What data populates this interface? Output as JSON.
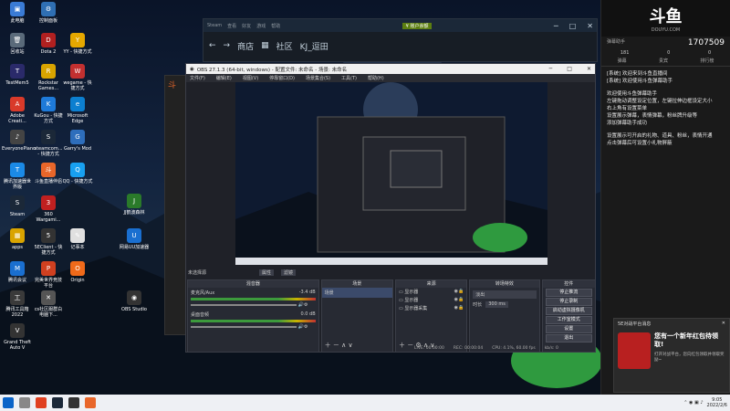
{
  "desktop": {
    "icons": [
      {
        "label": "此电脑",
        "color": "#3a7bd5",
        "glyph": "▣"
      },
      {
        "label": "控制面板",
        "color": "#2f6fb3",
        "glyph": "⚙"
      },
      {
        "label": "回收站",
        "color": "#5a6a7a",
        "glyph": "🗑"
      },
      {
        "label": "Dota 2",
        "color": "#b02020",
        "glyph": "D"
      },
      {
        "label": "YY - 快捷方式",
        "color": "#e6a800",
        "glyph": "Y"
      },
      {
        "label": "TestMem5",
        "color": "#2a2a6a",
        "glyph": "T"
      },
      {
        "label": "Rockstar Games...",
        "color": "#d9a400",
        "glyph": "R"
      },
      {
        "label": "wegame - 快捷方式",
        "color": "#c23030",
        "glyph": "W"
      },
      {
        "label": "Adobe Creati...",
        "color": "#d93a2a",
        "glyph": "A"
      },
      {
        "label": "KuGou - 快捷方式",
        "color": "#1e7ad9",
        "glyph": "K"
      },
      {
        "label": "Microsoft Edge",
        "color": "#0c7fd0",
        "glyph": "e"
      },
      {
        "label": "EveryonePiano",
        "color": "#444",
        "glyph": "♪"
      },
      {
        "label": "steamcom... - 快捷方式",
        "color": "#1b2838",
        "glyph": "S"
      },
      {
        "label": "Garry's Mod",
        "color": "#2e6ebc",
        "glyph": "G"
      },
      {
        "label": "腾讯加速器世界版",
        "color": "#1b8ae6",
        "glyph": "T"
      },
      {
        "label": "斗鱼直播伴侣",
        "color": "#e8662a",
        "glyph": "斗"
      },
      {
        "label": "QQ - 快捷方式",
        "color": "#18a0f0",
        "glyph": "Q"
      },
      {
        "label": "Steam",
        "color": "#1b2838",
        "glyph": "S"
      },
      {
        "label": "360 Wargami...",
        "color": "#c02020",
        "glyph": "3"
      },
      {
        "label": "JJ鹤波森林",
        "color": "#2a7a2a",
        "glyph": "J"
      },
      {
        "label": "apps",
        "color": "#d9a400",
        "glyph": "▦"
      },
      {
        "label": "5EClient - 快捷方式",
        "color": "#333",
        "glyph": "5"
      },
      {
        "label": "记事本",
        "color": "#e0e0e0",
        "glyph": "✎"
      },
      {
        "label": "网易UU加速器",
        "color": "#1a6fd0",
        "glyph": "U"
      },
      {
        "label": "腾讯会议",
        "color": "#1a6fd0",
        "glyph": "M"
      },
      {
        "label": "完美世界竞技平台",
        "color": "#d04020",
        "glyph": "P"
      },
      {
        "label": "Origin",
        "color": "#f06a1a",
        "glyph": "O"
      },
      {
        "label": "腾讯工具箱 2022",
        "color": "#3a3a3a",
        "glyph": "工"
      },
      {
        "label": "cs社区服群白电脑下...",
        "color": "#555",
        "glyph": "✕"
      },
      {
        "label": "OBS Studio",
        "color": "#333",
        "glyph": "◉"
      },
      {
        "label": "Grand Theft Auto V",
        "color": "#333",
        "glyph": "V"
      }
    ]
  },
  "store": {
    "tabs": [
      "Steam",
      "查看",
      "好友",
      "游戏",
      "帮助"
    ],
    "nav": [
      "商店",
      "社区",
      "KJ_逗田"
    ],
    "back": "←",
    "forward": "→",
    "account": "¥ 账户余额"
  },
  "obs": {
    "title": "OBS 27.1.3 (64-bit, windows) - 配置文件: 未命名 - 场景: 未命名",
    "menu": [
      "文件(F)",
      "编辑(E)",
      "视图(V)",
      "停靠窗口(D)",
      "场景集合(S)",
      "工具(T)",
      "帮助(H)"
    ],
    "source_bar_label": "未选择源",
    "props_label": "属性",
    "filter_label": "滤镜",
    "docks": {
      "mixer_title": "混音器",
      "mixer_tracks": [
        {
          "name": "麦克风/Aux",
          "db": "-3.4 dB"
        },
        {
          "name": "桌面音频",
          "db": "0.0 dB"
        }
      ],
      "scenes_title": "场景",
      "scenes": [
        "场景"
      ],
      "sources_title": "来源",
      "sources": [
        "显示器",
        "显示器",
        "显示器采集"
      ],
      "transitions_title": "转场特效",
      "transition_type": "淡出",
      "duration_label": "时长",
      "duration_value": "300 ms",
      "controls_title": "控件",
      "controls": [
        "停止推流",
        "停止录制",
        "启动虚拟摄像机",
        "工作室模式",
        "设置",
        "退出"
      ]
    },
    "status": [
      "LIVE: 00:00:00",
      "REC: 00:00:04",
      "CPU: 4.1%, 60.00 fps",
      "kb/s: 0"
    ]
  },
  "panel": {
    "logo": "斗鱼",
    "logo_sub": "DOUYU.COM",
    "room_label": "弹幕助手",
    "count": "1707509",
    "stats": [
      "181",
      "0",
      "0"
    ],
    "tabs": [
      "弹幕",
      "贵宾",
      "排行榜"
    ],
    "messages": [
      "[系统] 欢迎来到斗鱼直播间",
      "[系统] 欢迎使用斗鱼弹幕助手",
      "欢迎使用斗鱼弹幕助手",
      "左键拖动调整设定位置，左键拉伸边框设定大小",
      "右上角有设置菜单",
      "设置展示弹幕，表情弹幕，粉丝牌升级等",
      "添加弹幕助手成功",
      "设置展示可开启的礼物、道具、粉丝，表情开通",
      "点击弹幕后可设置小礼物屏蔽"
    ],
    "notif_title": "5E对战平台消息",
    "notif_headline": "您有一个新年红包待领取!",
    "notif_body": "打开对战平台，您向红包领取并领取奖励~",
    "notif_close": "✕"
  },
  "taskbar": {
    "time": "9:05",
    "date": "2022/2/6",
    "apps": [
      {
        "name": "windows-start",
        "color": "#0a64c8"
      },
      {
        "name": "search",
        "color": "#888"
      },
      {
        "name": "chrome",
        "color": "#e04020"
      },
      {
        "name": "steam",
        "color": "#1b2838"
      },
      {
        "name": "obs",
        "color": "#333"
      },
      {
        "name": "douyu",
        "color": "#e8662a"
      }
    ]
  },
  "colors": {
    "accent": "#e8662a",
    "obs_bg": "#1f2128",
    "steam": "#1b2838",
    "panel_bg": "#1a1a1a"
  }
}
